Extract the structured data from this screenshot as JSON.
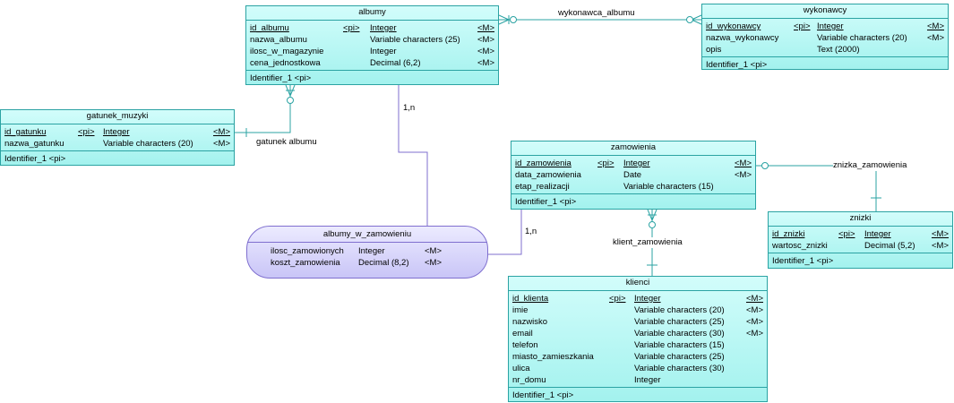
{
  "entities": {
    "albumy": {
      "title": "albumy",
      "attrs": [
        {
          "name": "id_albumu",
          "key": "<pi>",
          "type": "Integer",
          "mand": "<M>"
        },
        {
          "name": "nazwa_albumu",
          "key": "",
          "type": "Variable characters (25)",
          "mand": "<M>"
        },
        {
          "name": "ilosc_w_magazynie",
          "key": "",
          "type": "Integer",
          "mand": "<M>"
        },
        {
          "name": "cena_jednostkowa",
          "key": "",
          "type": "Decimal (6,2)",
          "mand": "<M>"
        }
      ],
      "identifier": "Identifier_1   <pi>"
    },
    "wykonawcy": {
      "title": "wykonawcy",
      "attrs": [
        {
          "name": "id_wykonawcy",
          "key": "<pi>",
          "type": "Integer",
          "mand": "<M>"
        },
        {
          "name": "nazwa_wykonawcy",
          "key": "",
          "type": "Variable characters (20)",
          "mand": "<M>"
        },
        {
          "name": "opis",
          "key": "",
          "type": "Text (2000)",
          "mand": ""
        }
      ],
      "identifier": "Identifier_1   <pi>"
    },
    "gatunek_muzyki": {
      "title": "gatunek_muzyki",
      "attrs": [
        {
          "name": "id_gatunku",
          "key": "<pi>",
          "type": "Integer",
          "mand": "<M>"
        },
        {
          "name": "nazwa_gatunku",
          "key": "",
          "type": "Variable characters (20)",
          "mand": "<M>"
        }
      ],
      "identifier": "Identifier_1   <pi>"
    },
    "zamowienia": {
      "title": "zamowienia",
      "attrs": [
        {
          "name": "id_zamowienia",
          "key": "<pi>",
          "type": "Integer",
          "mand": "<M>"
        },
        {
          "name": "data_zamowienia",
          "key": "",
          "type": "Date",
          "mand": "<M>"
        },
        {
          "name": "etap_realizacji",
          "key": "",
          "type": "Variable characters (15)",
          "mand": ""
        }
      ],
      "identifier": "Identifier_1   <pi>"
    },
    "znizki": {
      "title": "znizki",
      "attrs": [
        {
          "name": "id_znizki",
          "key": "<pi>",
          "type": "Integer",
          "mand": "<M>"
        },
        {
          "name": "wartosc_znizki",
          "key": "",
          "type": "Decimal (5,2)",
          "mand": "<M>"
        }
      ],
      "identifier": "Identifier_1   <pi>"
    },
    "klienci": {
      "title": "klienci",
      "attrs": [
        {
          "name": "id_klienta",
          "key": "<pi>",
          "type": "Integer",
          "mand": "<M>"
        },
        {
          "name": "imie",
          "key": "",
          "type": "Variable characters (20)",
          "mand": "<M>"
        },
        {
          "name": "nazwisko",
          "key": "",
          "type": "Variable characters (25)",
          "mand": "<M>"
        },
        {
          "name": "email",
          "key": "",
          "type": "Variable characters (30)",
          "mand": "<M>"
        },
        {
          "name": "telefon",
          "key": "",
          "type": "Variable characters (15)",
          "mand": ""
        },
        {
          "name": "miasto_zamieszkania",
          "key": "",
          "type": "Variable characters (25)",
          "mand": ""
        },
        {
          "name": "ulica",
          "key": "",
          "type": "Variable characters (30)",
          "mand": ""
        },
        {
          "name": "nr_domu",
          "key": "",
          "type": "Integer",
          "mand": ""
        }
      ],
      "identifier": "Identifier_1   <pi>"
    }
  },
  "association": {
    "title": "albumy_w_zamowieniu",
    "attrs": [
      {
        "name": "ilosc_zamowionych",
        "type": "Integer",
        "mand": "<M>"
      },
      {
        "name": "koszt_zamowienia",
        "type": "Decimal (8,2)",
        "mand": "<M>"
      }
    ]
  },
  "relationships": {
    "wykonawca_albumu": "wykonawca_albumu",
    "gatunek_albumu": "gatunek albumu",
    "znizka_zamowienia": "znizka_zamowienia",
    "klient_zamowienia": "klient_zamowienia",
    "card_albumy": "1,n",
    "card_zamowienia": "1,n"
  },
  "colors": {
    "entity_border": "#2ba3a3",
    "entity_fill": "#bff8f4",
    "association_border": "#7f6fcf",
    "association_fill": "#dcd9fb",
    "link_line": "#2ba3a3",
    "assoc_link_line": "#7f6fcf"
  }
}
